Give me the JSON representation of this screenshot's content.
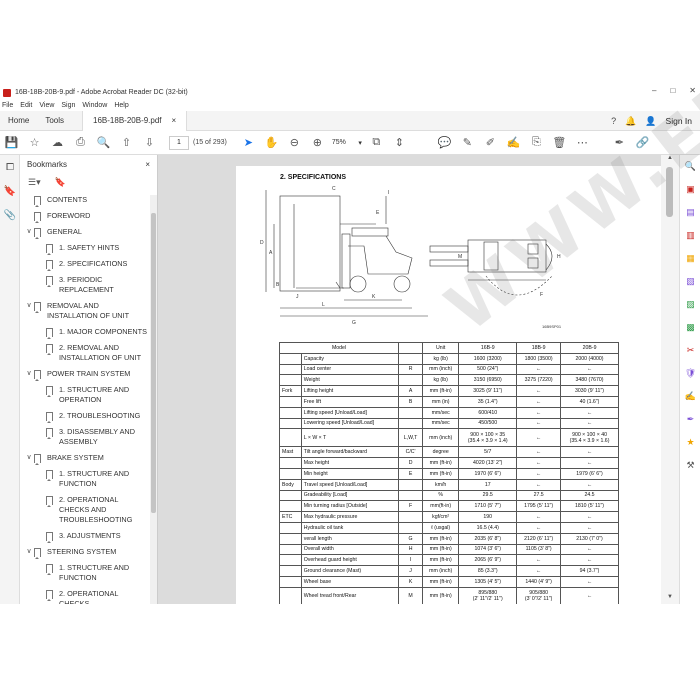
{
  "window": {
    "title": "16B-18B-20B-9.pdf - Adobe Acrobat Reader DC (32-bit)",
    "controls": [
      "–",
      "□",
      "✕"
    ]
  },
  "menu": [
    "File",
    "Edit",
    "View",
    "Sign",
    "Window",
    "Help"
  ],
  "tabs": {
    "home": "Home",
    "tools": "Tools",
    "document": "16B-18B-20B-9.pdf",
    "close": "×",
    "sign_in": "Sign In"
  },
  "toolbar": {
    "page_current": "1",
    "page_count": "(15 of 293)",
    "zoom": "75%"
  },
  "bookmarks": {
    "title": "Bookmarks",
    "close": "×",
    "items": [
      {
        "level": 0,
        "expand": "",
        "label": "CONTENTS"
      },
      {
        "level": 0,
        "expand": "",
        "label": "FOREWORD"
      },
      {
        "level": 0,
        "expand": "∨",
        "label": "GENERAL"
      },
      {
        "level": 1,
        "expand": "",
        "label": "1. SAFETY HINTS"
      },
      {
        "level": 1,
        "expand": "",
        "label": "2. SPECIFICATIONS"
      },
      {
        "level": 1,
        "expand": "",
        "label": "3. PERIODIC REPLACEMENT"
      },
      {
        "level": 0,
        "expand": "∨",
        "label": "REMOVAL AND INSTALLATION OF UNIT"
      },
      {
        "level": 1,
        "expand": "",
        "label": "1. MAJOR COMPONENTS"
      },
      {
        "level": 1,
        "expand": "",
        "label": "2. REMOVAL AND INSTALLATION OF UNIT"
      },
      {
        "level": 0,
        "expand": "∨",
        "label": "POWER TRAIN SYSTEM"
      },
      {
        "level": 1,
        "expand": "",
        "label": "1. STRUCTURE AND OPERATION"
      },
      {
        "level": 1,
        "expand": "",
        "label": "2. TROUBLESHOOTING"
      },
      {
        "level": 1,
        "expand": "",
        "label": "3. DISASSEMBLY AND ASSEMBLY"
      },
      {
        "level": 0,
        "expand": "∨",
        "label": "BRAKE SYSTEM"
      },
      {
        "level": 1,
        "expand": "",
        "label": "1. STRUCTURE AND FUNCTION"
      },
      {
        "level": 1,
        "expand": "",
        "label": "2. OPERATIONAL CHECKS AND TROUBLESHOOTING"
      },
      {
        "level": 1,
        "expand": "",
        "label": "3. ADJUSTMENTS"
      },
      {
        "level": 0,
        "expand": "∨",
        "label": "STEERING SYSTEM"
      },
      {
        "level": 1,
        "expand": "",
        "label": "1. STRUCTURE AND FUNCTION"
      },
      {
        "level": 1,
        "expand": "",
        "label": "2. OPERATIONAL CHECKS"
      }
    ]
  },
  "page": {
    "section_title": "2. SPECIFICATIONS",
    "figure_number": "16B9SP01",
    "watermark": "WWW.EPCDATA.COM",
    "diagram_labels": [
      "C",
      "I",
      "D",
      "A",
      "E",
      "B",
      "J",
      "L",
      "G",
      "K",
      "H",
      "M",
      "F"
    ],
    "table": {
      "headers": [
        "Model",
        "Unit",
        "16B-9",
        "18B-9",
        "20B-9"
      ],
      "rows": [
        {
          "group": "",
          "item": "Capacity",
          "sym": "",
          "unit": "kg (lb)",
          "v1": "1600 (3200)",
          "v2": "1800 (3500)",
          "v3": "2000 (4000)"
        },
        {
          "group": "",
          "item": "Load center",
          "sym": "R",
          "unit": "mm (inch)",
          "v1": "500 (24\")",
          "v2": "←",
          "v3": "←"
        },
        {
          "group": "",
          "item": "Weight",
          "sym": "",
          "unit": "kg (lb)",
          "v1": "3150 (6950)",
          "v2": "3275 (7220)",
          "v3": "3480 (7670)"
        },
        {
          "group": "Fork",
          "item": "Lifting height",
          "sym": "A",
          "unit": "mm (ft-in)",
          "v1": "3025 (9' 11\")",
          "v2": "←",
          "v3": "3030 (9' 11\")"
        },
        {
          "group": "",
          "item": "Free lift",
          "sym": "B",
          "unit": "mm (in)",
          "v1": "35 (1.4\")",
          "v2": "←",
          "v3": "40 (1.6\")"
        },
        {
          "group": "",
          "item": "Lifting speed [Unload/Load]",
          "sym": "",
          "unit": "mm/sec",
          "v1": "600/410",
          "v2": "←",
          "v3": "←"
        },
        {
          "group": "",
          "item": "Lowering speed [Unload/Load]",
          "sym": "",
          "unit": "mm/sec",
          "v1": "450/500",
          "v2": "←",
          "v3": "←"
        },
        {
          "group": "",
          "item": "L × W × T",
          "sym": "L,W,T",
          "unit": "mm (inch)",
          "v1": "900 × 100 × 35|(35.4 × 3.9 × 1.4)",
          "v2": "←",
          "v3": "900 × 100 × 40|(35.4 × 3.9 × 1.6)",
          "tall": true
        },
        {
          "group": "Mast",
          "item": "Tilt angle forward/backward",
          "sym": "C/C'",
          "unit": "degree",
          "v1": "5/7",
          "v2": "←",
          "v3": "←"
        },
        {
          "group": "",
          "item": "Max height",
          "sym": "D",
          "unit": "mm (ft-in)",
          "v1": "4020 (13' 2\")",
          "v2": "←",
          "v3": "←"
        },
        {
          "group": "",
          "item": "Min height",
          "sym": "E",
          "unit": "mm (ft-in)",
          "v1": "1970 (6' 6\")",
          "v2": "←",
          "v3": "1979 (6' 6\")"
        },
        {
          "group": "Body",
          "item": "Travel speed [Unload/Load]",
          "sym": "",
          "unit": "km/h",
          "v1": "17",
          "v2": "←",
          "v3": "←"
        },
        {
          "group": "",
          "item": "Gradeability [Load]",
          "sym": "",
          "unit": "%",
          "v1": "29.5",
          "v2": "27.5",
          "v3": "24.5"
        },
        {
          "group": "",
          "item": "Min turning radius [Outside]",
          "sym": "F",
          "unit": "mm(ft-in)",
          "v1": "1710 (5' 7\")",
          "v2": "1795 (5' 11\")",
          "v3": "1810 (5' 11\")"
        },
        {
          "group": "ETC",
          "item": "Max hydraulic pressure",
          "sym": "",
          "unit": "kgf/cm²",
          "v1": "190",
          "v2": "←",
          "v3": "←"
        },
        {
          "group": "",
          "item": "Hydraulic oil tank",
          "sym": "",
          "unit": "ℓ (usgal)",
          "v1": "16.5 (4.4)",
          "v2": "←",
          "v3": "←"
        },
        {
          "group": "",
          "item": "verall length",
          "sym": "G",
          "unit": "mm (ft-in)",
          "v1": "2035 (6' 8\")",
          "v2": "2120 (6' 11\")",
          "v3": "2130 (7' 0\")"
        },
        {
          "group": "",
          "item": "Overall width",
          "sym": "H",
          "unit": "mm (ft-in)",
          "v1": "1074 (3' 6\")",
          "v2": "1105 (3' 8\")",
          "v3": "←"
        },
        {
          "group": "",
          "item": "Overhead guard height",
          "sym": "I",
          "unit": "mm (ft-in)",
          "v1": "2065 (6' 9\")",
          "v2": "←",
          "v3": "←"
        },
        {
          "group": "",
          "item": "Ground clearance (Mast)",
          "sym": "J",
          "unit": "mm (inch)",
          "v1": "85 (3.3\")",
          "v2": "←",
          "v3": "94 (3.7\")"
        },
        {
          "group": "",
          "item": "Wheel base",
          "sym": "K",
          "unit": "mm (ft-in)",
          "v1": "1305 (4' 5\")",
          "v2": "1440 (4' 9\")",
          "v3": "←"
        },
        {
          "group": "",
          "item": "Wheel tread front/Rear",
          "sym": "M",
          "unit": "mm (ft-in)",
          "v1": "895/880|(2' 11\"/2' 11\")",
          "v2": "905/880|(3' 0\"/2' 11\")",
          "v3": "←",
          "tall": true
        }
      ]
    }
  },
  "colors": {
    "accent": "#1a73e8",
    "viewer_bg": "#dcdcdc",
    "acrobat_red": "#c8201b"
  }
}
